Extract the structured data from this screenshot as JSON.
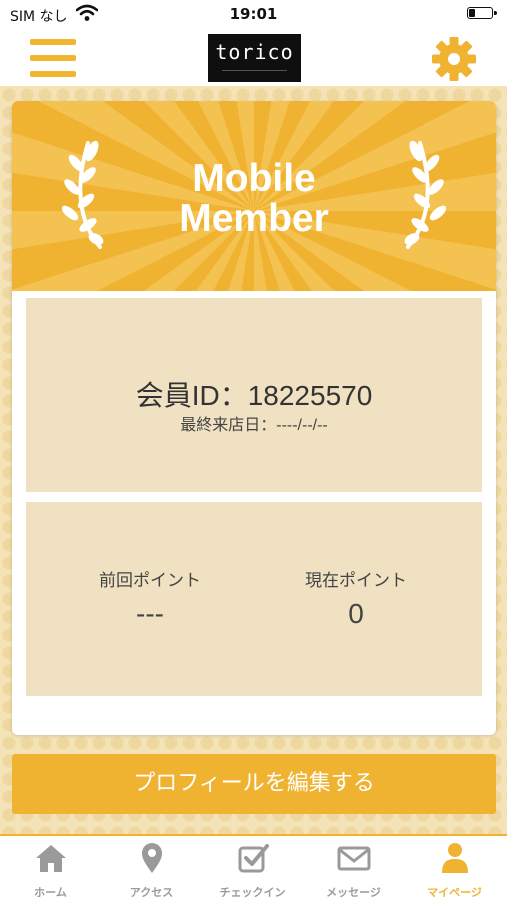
{
  "status": {
    "carrier": "SIM なし",
    "time": "19:01"
  },
  "header": {
    "logo_text": "torico",
    "logo_tagline": "ayurveda salon"
  },
  "card": {
    "title_line1": "Mobile",
    "title_line2": "Member",
    "member_id": "会員ID：18225570",
    "last_visit": "最終来店日：----/--/--",
    "prev_points_label": "前回ポイント",
    "prev_points_value": "---",
    "current_points_label": "現在ポイント",
    "current_points_value": "0"
  },
  "profile_button": "プロフィールを編集する",
  "tabs": [
    {
      "label": "ホーム",
      "icon": "home-icon",
      "active": false
    },
    {
      "label": "アクセス",
      "icon": "map-pin-icon",
      "active": false
    },
    {
      "label": "チェックイン",
      "icon": "checkin-icon",
      "active": false
    },
    {
      "label": "メッセージ",
      "icon": "mail-icon",
      "active": false
    },
    {
      "label": "マイページ",
      "icon": "user-icon",
      "active": true
    }
  ],
  "colors": {
    "accent": "#f0b331",
    "panel": "#efe1c2",
    "inactive": "#9a9a9a"
  }
}
